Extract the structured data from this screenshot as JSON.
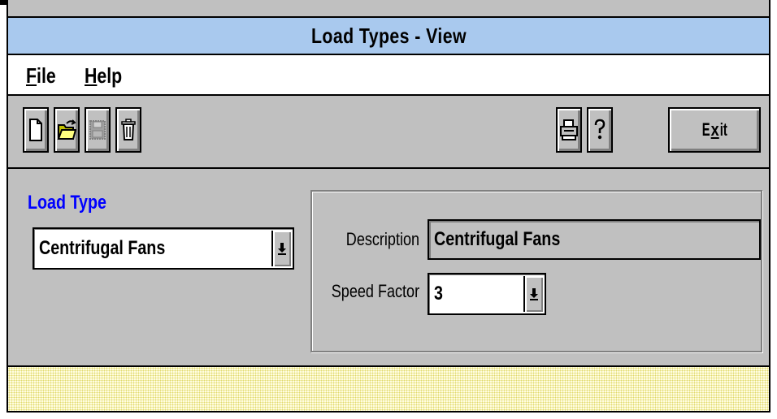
{
  "window": {
    "title": "Load Types - View"
  },
  "menu": [
    {
      "mnemonic": "F",
      "rest": "ile"
    },
    {
      "mnemonic": "H",
      "rest": "elp"
    }
  ],
  "toolbar": {
    "buttons": [
      {
        "icon": "new-document-icon"
      },
      {
        "icon": "open-folder-icon"
      },
      {
        "icon": "save-disk-icon",
        "disabled": true
      },
      {
        "icon": "delete-trash-icon"
      },
      {
        "icon": "print-icon"
      },
      {
        "icon": "help-question-icon"
      }
    ],
    "exit": {
      "pre": "E",
      "mnemonic": "x",
      "post": "it"
    }
  },
  "form": {
    "load_type_label": "Load Type",
    "load_type_value": "Centrifugal Fans",
    "description_label": "Description",
    "description_value": "Centrifugal Fans",
    "speed_factor_label": "Speed Factor",
    "speed_factor_value": "3"
  },
  "colors": {
    "titlebar": "#a9c9ee",
    "label_accent": "#0000ff",
    "window_face": "#c0c0c0",
    "statusbar": "#fffde0"
  }
}
